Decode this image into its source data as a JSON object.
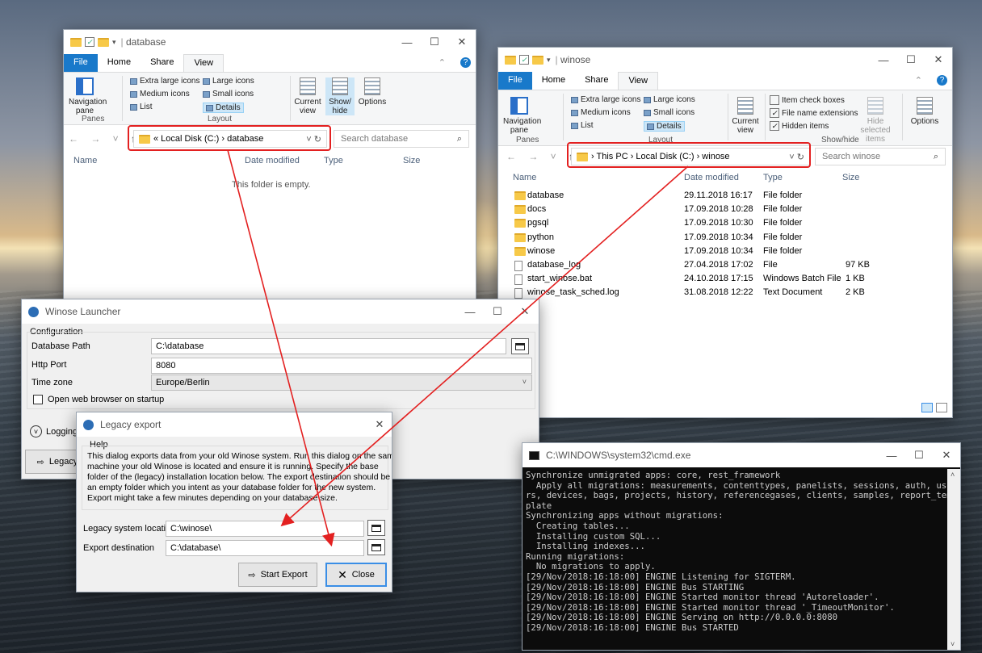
{
  "explorer_database": {
    "title": "database",
    "tabs": [
      "File",
      "Home",
      "Share",
      "View"
    ],
    "layout_items": [
      "Extra large icons",
      "Large icons",
      "Medium icons",
      "Small icons",
      "List",
      "Details"
    ],
    "nav_pane": "Navigation pane",
    "current_view": "Current view",
    "show_hide": "Show/ hide",
    "options": "Options",
    "group_panes": "Panes",
    "group_layout": "Layout",
    "address": "« Local Disk (C:) › database",
    "search_placeholder": "Search database",
    "columns": [
      "Name",
      "Date modified",
      "Type",
      "Size"
    ],
    "empty_text": "This folder is empty."
  },
  "explorer_winose": {
    "title": "winose",
    "tabs": [
      "File",
      "Home",
      "Share",
      "View"
    ],
    "layout_items": [
      "Extra large icons",
      "Large icons",
      "Medium icons",
      "Small icons",
      "List",
      "Details"
    ],
    "nav_pane": "Navigation pane",
    "current_view": "Current view",
    "checks": [
      "Item check boxes",
      "File name extensions",
      "Hidden items"
    ],
    "hide_selected": "Hide selected items",
    "options": "Options",
    "group_panes": "Panes",
    "group_layout": "Layout",
    "group_showhide": "Show/hide",
    "address": "› This PC › Local Disk (C:) › winose",
    "search_placeholder": "Search winose",
    "columns": [
      "Name",
      "Date modified",
      "Type",
      "Size"
    ],
    "files": [
      {
        "name": "database",
        "date": "29.11.2018 16:17",
        "type": "File folder",
        "size": "",
        "kind": "folder"
      },
      {
        "name": "docs",
        "date": "17.09.2018 10:28",
        "type": "File folder",
        "size": "",
        "kind": "folder"
      },
      {
        "name": "pgsql",
        "date": "17.09.2018 10:30",
        "type": "File folder",
        "size": "",
        "kind": "folder"
      },
      {
        "name": "python",
        "date": "17.09.2018 10:34",
        "type": "File folder",
        "size": "",
        "kind": "folder"
      },
      {
        "name": "winose",
        "date": "17.09.2018 10:34",
        "type": "File folder",
        "size": "",
        "kind": "folder"
      },
      {
        "name": "database_log",
        "date": "27.04.2018 17:02",
        "type": "File",
        "size": "97 KB",
        "kind": "file"
      },
      {
        "name": "start_winose.bat",
        "date": "24.10.2018 17:15",
        "type": "Windows Batch File",
        "size": "1 KB",
        "kind": "bat"
      },
      {
        "name": "winose_task_sched.log",
        "date": "31.08.2018 12:22",
        "type": "Text Document",
        "size": "2 KB",
        "kind": "txt"
      }
    ]
  },
  "launcher": {
    "title": "Winose Launcher",
    "section": "Configuration",
    "db_path_label": "Database Path",
    "db_path_value": "C:\\database",
    "http_port_label": "Http Port",
    "http_port_value": "8080",
    "timezone_label": "Time zone",
    "timezone_value": "Europe/Berlin",
    "open_browser": "Open web browser on startup",
    "logging": "Logging",
    "legacy_btn": "Legacy"
  },
  "legacy": {
    "title": "Legacy export",
    "help_heading": "Help",
    "help_lines": [
      "This dialog exports data from your old Winose system. Run this dialog on the same",
      "machine your old Winose is located and ensure it is running. Specify the base",
      "folder of the (legacy) installation location below. The export destination should be",
      "an empty folder which you intent as your database folder for the new system.",
      "Export might take a few minutes depending on your database size."
    ],
    "location_label": "Legacy system location",
    "location_value": "C:\\winose\\",
    "destination_label": "Export destination",
    "destination_value": "C:\\database\\",
    "start_btn": "Start Export",
    "close_btn": "Close"
  },
  "cmd": {
    "title": "C:\\WINDOWS\\system32\\cmd.exe",
    "lines": [
      "Synchronize unmigrated apps: core, rest_framework",
      "  Apply all migrations: measurements, contenttypes, panelists, sessions, auth, use",
      "rs, devices, bags, projects, history, referencegases, clients, samples, report_tem",
      "plate",
      "Synchronizing apps without migrations:",
      "  Creating tables...",
      "  Installing custom SQL...",
      "  Installing indexes...",
      "Running migrations:",
      "  No migrations to apply.",
      "[29/Nov/2018:16:18:00] ENGINE Listening for SIGTERM.",
      "[29/Nov/2018:16:18:00] ENGINE Bus STARTING",
      "[29/Nov/2018:16:18:00] ENGINE Started monitor thread 'Autoreloader'.",
      "[29/Nov/2018:16:18:00] ENGINE Started monitor thread '_TimeoutMonitor'.",
      "[29/Nov/2018:16:18:00] ENGINE Serving on http://0.0.0.0:8080",
      "[29/Nov/2018:16:18:00] ENGINE Bus STARTED"
    ]
  },
  "colors": {
    "accent": "#1979ca",
    "annotation": "#e32020",
    "console_bg": "#0c0c0c",
    "folder": "#f7c948"
  }
}
